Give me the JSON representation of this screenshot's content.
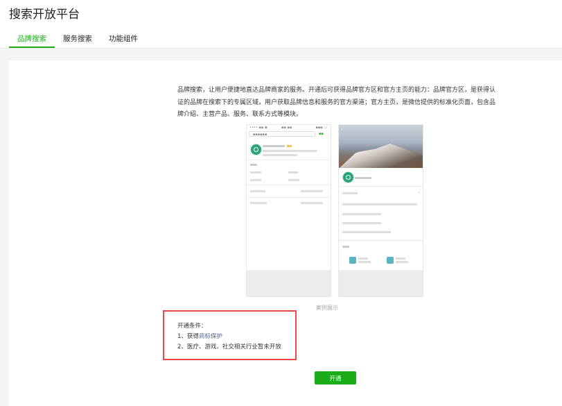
{
  "page": {
    "title": "搜索开放平台"
  },
  "tabs": [
    {
      "label": "品牌搜索",
      "active": true
    },
    {
      "label": "服务搜索",
      "active": false
    },
    {
      "label": "功能组件",
      "active": false
    }
  ],
  "main": {
    "description": "品牌搜索，让用户便捷地直达品牌商家的服务。开通后可获得品牌官方区和官方主页的能力：品牌官方区，是获得认证的品牌在搜索下的专属区域，用户获取品牌信息和服务的官方渠道；官方主页，是微信提供的标准化页面，包含品牌介绍、主营产品、服务、联系方式等模块。",
    "example_caption": "案例展示",
    "conditions": {
      "title": "开通条件：",
      "item1_prefix": "1、获得",
      "item1_link": "商标保护",
      "item2": "2、医疗、游戏、社交相关行业暂未开放"
    },
    "open_button": "开通"
  },
  "colors": {
    "accent": "#1aad19",
    "link": "#576b95",
    "highlight_border": "#e84a48"
  }
}
